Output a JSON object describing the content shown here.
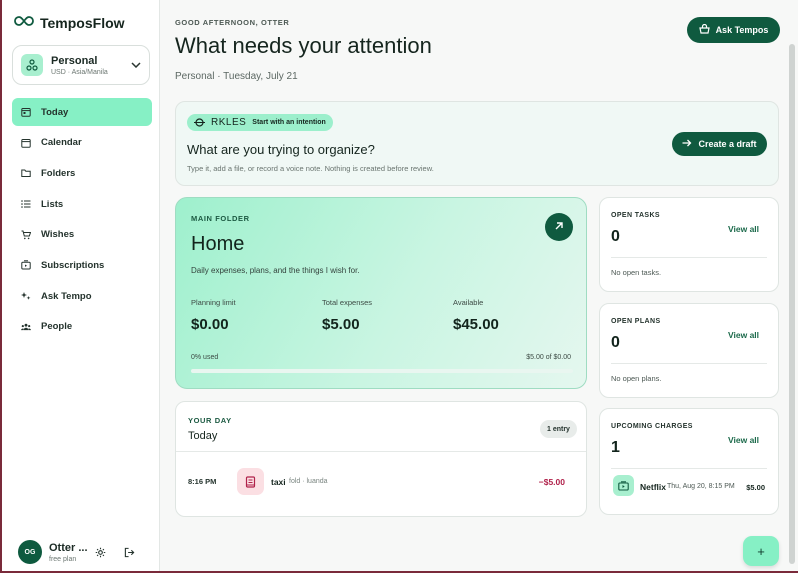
{
  "app": {
    "name": "TemposFlow"
  },
  "workspace": {
    "name": "Personal",
    "sub": "USD · Asia/Manila"
  },
  "nav": [
    {
      "label": "Today",
      "icon": "calendar-today-icon",
      "active": true
    },
    {
      "label": "Calendar",
      "icon": "calendar-icon"
    },
    {
      "label": "Folders",
      "icon": "folder-icon"
    },
    {
      "label": "Lists",
      "icon": "list-icon"
    },
    {
      "label": "Wishes",
      "icon": "cart-icon"
    },
    {
      "label": "Subscriptions",
      "icon": "subscription-icon"
    },
    {
      "label": "Ask Tempo",
      "icon": "sparkle-icon"
    },
    {
      "label": "People",
      "icon": "people-icon"
    }
  ],
  "user": {
    "initials": "OG",
    "name": "Otter ...",
    "plan": "free plan"
  },
  "header": {
    "greeting": "GOOD AFTERNOON, OTTER",
    "title": "What needs your attention",
    "subtitle": "Personal · Tuesday, July 21",
    "ask_button": "Ask Tempos"
  },
  "intention": {
    "logo_text": "RKLES",
    "pill": "Start with an intention",
    "question": "What are you trying to organize?",
    "hint": "Type it, add a file, or record a voice note. Nothing is created before review.",
    "draft_button": "Create a draft"
  },
  "main_folder": {
    "label": "MAIN FOLDER",
    "name": "Home",
    "description": "Daily expenses, plans, and the things I wish for.",
    "planning_label": "Planning limit",
    "planning_value": "$0.00",
    "expenses_label": "Total expenses",
    "expenses_value": "$5.00",
    "available_label": "Available",
    "available_value": "$45.00",
    "used_text": "0% used",
    "used_fraction": 0,
    "used_right": "$5.00 of $0.00"
  },
  "your_day": {
    "label": "YOUR DAY",
    "title": "Today",
    "badge": "1 entry",
    "entries": [
      {
        "time": "8:16 PM",
        "name": "taxi",
        "meta": "fold · luanda",
        "amount": "−$5.00"
      }
    ]
  },
  "open_tasks": {
    "label": "OPEN TASKS",
    "count": "0",
    "view": "View all",
    "empty": "No open tasks."
  },
  "open_plans": {
    "label": "OPEN PLANS",
    "count": "0",
    "view": "View all",
    "empty": "No open plans."
  },
  "upcoming": {
    "label": "UPCOMING CHARGES",
    "count": "1",
    "view": "View all",
    "item": {
      "name": "Netflix",
      "date": "Thu, Aug 20, 8:15 PM",
      "amount": "$5.00"
    }
  },
  "fab": {
    "label": "+"
  },
  "colors": {
    "accent": "#0f5a3f",
    "accent_light": "#86f0c5",
    "negative": "#b0214a"
  }
}
